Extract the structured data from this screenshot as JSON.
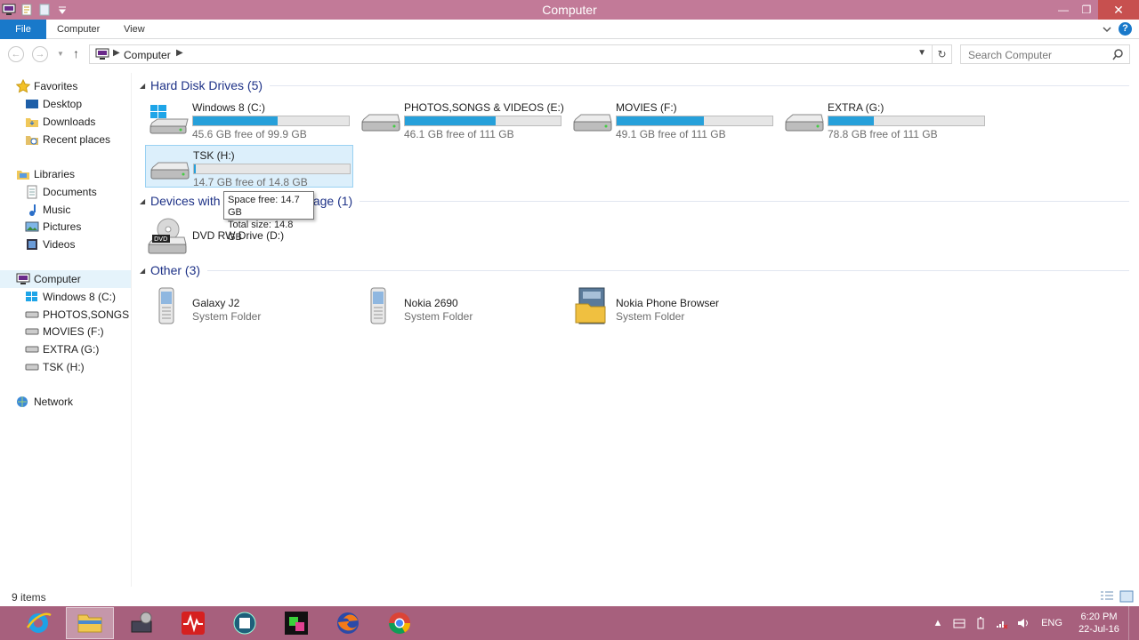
{
  "window": {
    "title": "Computer"
  },
  "ribbon": {
    "file": "File",
    "tabs": [
      "Computer",
      "View"
    ]
  },
  "navbar": {
    "breadcrumb": "Computer",
    "search_placeholder": "Search Computer"
  },
  "sidebar": {
    "favorites": "Favorites",
    "favorites_items": [
      "Desktop",
      "Downloads",
      "Recent places"
    ],
    "libraries": "Libraries",
    "libraries_items": [
      "Documents",
      "Music",
      "Pictures",
      "Videos"
    ],
    "computer": "Computer",
    "computer_items": [
      "Windows 8 (C:)",
      "PHOTOS,SONGS & VIDEOS (E:)",
      "MOVIES (F:)",
      "EXTRA (G:)",
      "TSK (H:)"
    ],
    "network": "Network"
  },
  "groups": {
    "hdd": {
      "title": "Hard Disk Drives (5)"
    },
    "devices": {
      "title": "Devices with Removable Storage (1)"
    },
    "other": {
      "title": "Other (3)"
    }
  },
  "drives": [
    {
      "name": "Windows 8 (C:)",
      "free": "45.6 GB free of 99.9 GB",
      "used_fraction": 0.54
    },
    {
      "name": "PHOTOS,SONGS & VIDEOS (E:)",
      "free": "46.1 GB free of 111 GB",
      "used_fraction": 0.58
    },
    {
      "name": "MOVIES (F:)",
      "free": "49.1 GB free of 111 GB",
      "used_fraction": 0.56
    },
    {
      "name": "EXTRA (G:)",
      "free": "78.8 GB free of 111 GB",
      "used_fraction": 0.29
    },
    {
      "name": "TSK (H:)",
      "free": "14.7 GB free of 14.8 GB",
      "used_fraction": 0.01
    }
  ],
  "removable": [
    {
      "name": "DVD RW Drive (D:)"
    }
  ],
  "other": [
    {
      "name": "Galaxy J2",
      "sub": "System Folder"
    },
    {
      "name": "Nokia 2690",
      "sub": "System Folder"
    },
    {
      "name": "Nokia Phone Browser",
      "sub": "System Folder"
    }
  ],
  "tooltip": {
    "line1": "Space free: 14.7 GB",
    "line2": "Total size: 14.8 GB"
  },
  "status": {
    "count": "9 items"
  },
  "taskbar": {
    "lang": "ENG",
    "time": "6:20 PM",
    "date": "22-Jul-16"
  },
  "colors": {
    "titlebar": "#c27a98",
    "taskbar": "#a7607d",
    "accent": "#1979ca",
    "drive_fill": "#26a0da"
  }
}
